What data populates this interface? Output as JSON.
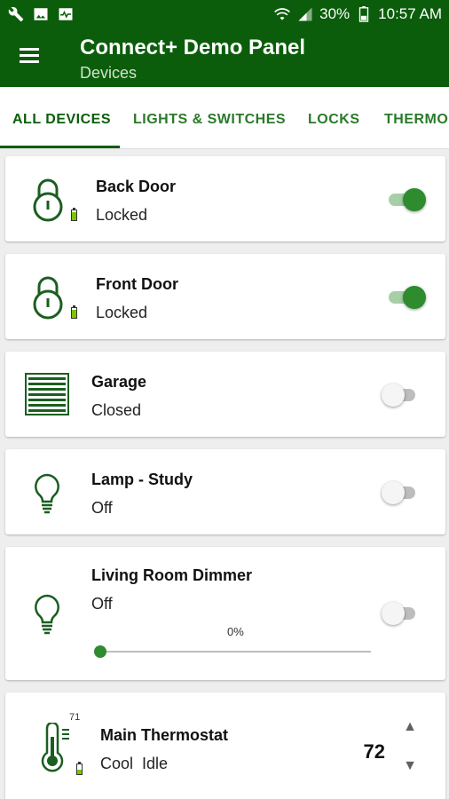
{
  "status_bar": {
    "battery_pct": "30%",
    "time": "10:57 AM",
    "left_icons": [
      "wrench-icon",
      "image-icon",
      "activity-icon"
    ],
    "right_icons": [
      "wifi-icon",
      "signal-icon",
      "battery-icon"
    ]
  },
  "app_bar": {
    "title": "Connect+ Demo Panel",
    "subtitle": "Devices",
    "menu_icon": "hamburger-menu-icon"
  },
  "tabs": [
    {
      "label": "ALL DEVICES",
      "active": true
    },
    {
      "label": "LIGHTS & SWITCHES",
      "active": false
    },
    {
      "label": "LOCKS",
      "active": false
    },
    {
      "label": "THERMO",
      "active": false
    }
  ],
  "devices": [
    {
      "name": "Back Door",
      "status": "Locked",
      "icon": "lock-icon",
      "on": true,
      "battery_fraction": 0.8
    },
    {
      "name": "Front Door",
      "status": "Locked",
      "icon": "lock-icon",
      "on": true,
      "battery_fraction": 0.8
    },
    {
      "name": "Garage",
      "status": "Closed",
      "icon": "garage-door-icon",
      "on": false
    },
    {
      "name": "Lamp - Study",
      "status": "Off",
      "icon": "lightbulb-icon",
      "on": false
    },
    {
      "name": "Living Room Dimmer",
      "status": "Off",
      "icon": "lightbulb-icon",
      "on": false,
      "level_label": "0%",
      "level": 0
    }
  ],
  "thermostat": {
    "name": "Main Thermostat",
    "status": "Cool  Idle",
    "current_temp": "71",
    "setpoint": "72",
    "icon": "thermometer-icon",
    "battery_fraction": 0.5,
    "up_arrow": "▲",
    "down_arrow": "▼"
  },
  "colors": {
    "primary": "#0b5d0b",
    "accent": "#2e8b2e",
    "background": "#eeeeee"
  }
}
